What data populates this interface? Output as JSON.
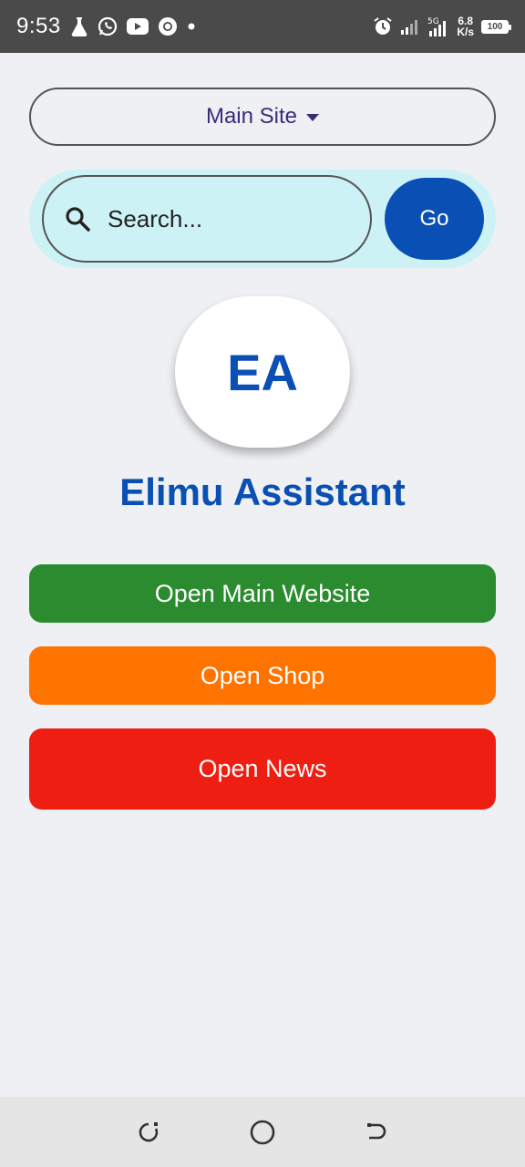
{
  "status_bar": {
    "time": "9:53",
    "network_speed_value": "6.8",
    "network_speed_unit": "K/s",
    "battery": "100",
    "left_icons": [
      "flask-icon",
      "whatsapp-icon",
      "youtube-icon",
      "chrome-icon",
      "dot-icon"
    ],
    "right_icons": [
      "alarm-icon",
      "signal-icon",
      "signal-5g-icon",
      "battery-icon"
    ]
  },
  "site_selector": {
    "selected": "Main Site"
  },
  "search": {
    "placeholder": "Search...",
    "value": "",
    "go_label": "Go"
  },
  "avatar": {
    "initials": "EA"
  },
  "app_title": "Elimu Assistant",
  "actions": {
    "main_website": "Open Main Website",
    "shop": "Open Shop",
    "news": "Open News"
  },
  "colors": {
    "primary_blue": "#0a4fb3",
    "green": "#2a8c2e",
    "orange": "#ff7300",
    "red": "#ef1e12",
    "search_bg": "#cdf2f5",
    "page_bg": "#eef0f3"
  },
  "nav_bar": {
    "icons": [
      "recent-apps-icon",
      "home-icon",
      "back-icon"
    ]
  }
}
